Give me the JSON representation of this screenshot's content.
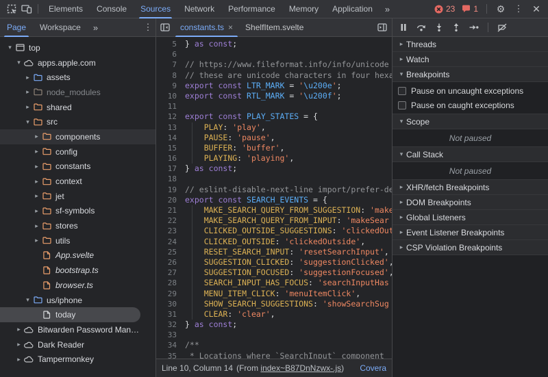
{
  "toolbar": {
    "tabs": [
      {
        "label": "Elements"
      },
      {
        "label": "Console"
      },
      {
        "label": "Sources",
        "active": true
      },
      {
        "label": "Network"
      },
      {
        "label": "Performance"
      },
      {
        "label": "Memory"
      },
      {
        "label": "Application"
      }
    ],
    "more_label": "»",
    "error_count": "23",
    "issue_count": "1",
    "gear": "⚙",
    "kebab": "⋮",
    "close": "✕"
  },
  "sidebar": {
    "tabs": [
      {
        "label": "Page",
        "active": true
      },
      {
        "label": "Workspace"
      }
    ],
    "more_label": "»",
    "kebab": "⋮",
    "tree": [
      {
        "label": "top",
        "icon": "frame",
        "color": "gray",
        "depth": 0,
        "chevron": "down"
      },
      {
        "label": "apps.apple.com",
        "icon": "cloud",
        "color": "gray",
        "depth": 1,
        "chevron": "down"
      },
      {
        "label": "assets",
        "icon": "folder",
        "color": "blue",
        "depth": 2,
        "chevron": "right"
      },
      {
        "label": "node_modules",
        "icon": "folder",
        "color": "dim",
        "depth": 2,
        "chevron": "right",
        "dim": true
      },
      {
        "label": "shared",
        "icon": "folder",
        "color": "orange",
        "depth": 2,
        "chevron": "right"
      },
      {
        "label": "src",
        "icon": "folder",
        "color": "orange",
        "depth": 2,
        "chevron": "down"
      },
      {
        "label": "components",
        "icon": "folder",
        "color": "orange",
        "depth": 3,
        "chevron": "right",
        "row": "hl"
      },
      {
        "label": "config",
        "icon": "folder",
        "color": "orange",
        "depth": 3,
        "chevron": "right"
      },
      {
        "label": "constants",
        "icon": "folder",
        "color": "orange",
        "depth": 3,
        "chevron": "right"
      },
      {
        "label": "context",
        "icon": "folder",
        "color": "orange",
        "depth": 3,
        "chevron": "right"
      },
      {
        "label": "jet",
        "icon": "folder",
        "color": "orange",
        "depth": 3,
        "chevron": "right"
      },
      {
        "label": "sf-symbols",
        "icon": "folder",
        "color": "orange",
        "depth": 3,
        "chevron": "right"
      },
      {
        "label": "stores",
        "icon": "folder",
        "color": "orange",
        "depth": 3,
        "chevron": "right"
      },
      {
        "label": "utils",
        "icon": "folder",
        "color": "orange",
        "depth": 3,
        "chevron": "right"
      },
      {
        "label": "App.svelte",
        "icon": "file",
        "color": "orange",
        "depth": 3,
        "italic": true
      },
      {
        "label": "bootstrap.ts",
        "icon": "file",
        "color": "orange",
        "depth": 3,
        "italic": true
      },
      {
        "label": "browser.ts",
        "icon": "file",
        "color": "orange",
        "depth": 3,
        "italic": true
      },
      {
        "label": "us/iphone",
        "icon": "folder",
        "color": "blue",
        "depth": 2,
        "chevron": "down"
      },
      {
        "label": "today",
        "icon": "file",
        "color": "white",
        "depth": 3,
        "row": "sel"
      },
      {
        "label": "Bitwarden Password Man…",
        "icon": "cloud",
        "color": "gray",
        "depth": 1,
        "chevron": "right"
      },
      {
        "label": "Dark Reader",
        "icon": "cloud",
        "color": "gray",
        "depth": 1,
        "chevron": "right"
      },
      {
        "label": "Tampermonkey",
        "icon": "cloud",
        "color": "gray",
        "depth": 1,
        "chevron": "right"
      }
    ]
  },
  "editor": {
    "tabs": [
      {
        "label": "constants.ts",
        "active": true,
        "close": "×"
      },
      {
        "label": "ShelfItem.svelte"
      }
    ],
    "lines": [
      {
        "n": 5,
        "seg": [
          [
            "p",
            "} "
          ],
          [
            "k",
            "as"
          ],
          [
            "p",
            " "
          ],
          [
            "k",
            "const"
          ],
          [
            "p",
            ";"
          ]
        ]
      },
      {
        "n": 6,
        "seg": []
      },
      {
        "n": 7,
        "seg": [
          [
            "c",
            "// https://www.fileformat.info/info/unicode"
          ]
        ]
      },
      {
        "n": 8,
        "seg": [
          [
            "c",
            "// these are unicode characters in four hexa"
          ]
        ]
      },
      {
        "n": 9,
        "seg": [
          [
            "k",
            "export"
          ],
          [
            "p",
            " "
          ],
          [
            "k",
            "const"
          ],
          [
            "p",
            " "
          ],
          [
            "d",
            "LTR_MARK"
          ],
          [
            "p",
            " = "
          ],
          [
            "s",
            "'"
          ],
          [
            "e",
            "\\u200e"
          ],
          [
            "s",
            "'"
          ],
          [
            "p",
            ";"
          ]
        ]
      },
      {
        "n": 10,
        "seg": [
          [
            "k",
            "export"
          ],
          [
            "p",
            " "
          ],
          [
            "k",
            "const"
          ],
          [
            "p",
            " "
          ],
          [
            "d",
            "RTL_MARK"
          ],
          [
            "p",
            " = "
          ],
          [
            "s",
            "'"
          ],
          [
            "e",
            "\\u200f"
          ],
          [
            "s",
            "'"
          ],
          [
            "p",
            ";"
          ]
        ]
      },
      {
        "n": 11,
        "seg": []
      },
      {
        "n": 12,
        "seg": [
          [
            "k",
            "export"
          ],
          [
            "p",
            " "
          ],
          [
            "k",
            "const"
          ],
          [
            "p",
            " "
          ],
          [
            "d",
            "PLAY_STATES"
          ],
          [
            "p",
            " = {"
          ]
        ]
      },
      {
        "n": 13,
        "guide": true,
        "seg": [
          [
            "p",
            "    "
          ],
          [
            "pr",
            "PLAY"
          ],
          [
            "p",
            ": "
          ],
          [
            "s",
            "'play'"
          ],
          [
            "p",
            ","
          ]
        ]
      },
      {
        "n": 14,
        "guide": true,
        "seg": [
          [
            "p",
            "    "
          ],
          [
            "pr",
            "PAUSE"
          ],
          [
            "p",
            ": "
          ],
          [
            "s",
            "'pause'"
          ],
          [
            "p",
            ","
          ]
        ]
      },
      {
        "n": 15,
        "guide": true,
        "seg": [
          [
            "p",
            "    "
          ],
          [
            "pr",
            "BUFFER"
          ],
          [
            "p",
            ": "
          ],
          [
            "s",
            "'buffer'"
          ],
          [
            "p",
            ","
          ]
        ]
      },
      {
        "n": 16,
        "guide": true,
        "seg": [
          [
            "p",
            "    "
          ],
          [
            "pr",
            "PLAYING"
          ],
          [
            "p",
            ": "
          ],
          [
            "s",
            "'playing'"
          ],
          [
            "p",
            ","
          ]
        ]
      },
      {
        "n": 17,
        "seg": [
          [
            "p",
            "} "
          ],
          [
            "k",
            "as"
          ],
          [
            "p",
            " "
          ],
          [
            "k",
            "const"
          ],
          [
            "p",
            ";"
          ]
        ]
      },
      {
        "n": 18,
        "seg": []
      },
      {
        "n": 19,
        "seg": [
          [
            "c",
            "// eslint-disable-next-line import/prefer-de"
          ]
        ]
      },
      {
        "n": 20,
        "seg": [
          [
            "k",
            "export"
          ],
          [
            "p",
            " "
          ],
          [
            "k",
            "const"
          ],
          [
            "p",
            " "
          ],
          [
            "d",
            "SEARCH_EVENTS"
          ],
          [
            "p",
            " = {"
          ]
        ]
      },
      {
        "n": 21,
        "guide": true,
        "seg": [
          [
            "p",
            "    "
          ],
          [
            "pr",
            "MAKE_SEARCH_QUERY_FROM_SUGGESTION"
          ],
          [
            "p",
            ": "
          ],
          [
            "s",
            "'make"
          ]
        ]
      },
      {
        "n": 22,
        "guide": true,
        "seg": [
          [
            "p",
            "    "
          ],
          [
            "pr",
            "MAKE_SEARCH_QUERY_FROM_INPUT"
          ],
          [
            "p",
            ": "
          ],
          [
            "s",
            "'makeSear"
          ]
        ]
      },
      {
        "n": 23,
        "guide": true,
        "seg": [
          [
            "p",
            "    "
          ],
          [
            "pr",
            "CLICKED_OUTSIDE_SUGGESTIONS"
          ],
          [
            "p",
            ": "
          ],
          [
            "s",
            "'clickedOut"
          ]
        ]
      },
      {
        "n": 24,
        "guide": true,
        "seg": [
          [
            "p",
            "    "
          ],
          [
            "pr",
            "CLICKED_OUTSIDE"
          ],
          [
            "p",
            ": "
          ],
          [
            "s",
            "'clickedOutside'"
          ],
          [
            "p",
            ","
          ]
        ]
      },
      {
        "n": 25,
        "guide": true,
        "seg": [
          [
            "p",
            "    "
          ],
          [
            "pr",
            "RESET_SEARCH_INPUT"
          ],
          [
            "p",
            ": "
          ],
          [
            "s",
            "'resetSearchInput'"
          ],
          [
            "p",
            ","
          ]
        ]
      },
      {
        "n": 26,
        "guide": true,
        "seg": [
          [
            "p",
            "    "
          ],
          [
            "pr",
            "SUGGESTION_CLICKED"
          ],
          [
            "p",
            ": "
          ],
          [
            "s",
            "'suggestionClicked'"
          ],
          [
            "p",
            ","
          ]
        ]
      },
      {
        "n": 27,
        "guide": true,
        "seg": [
          [
            "p",
            "    "
          ],
          [
            "pr",
            "SUGGESTION_FOCUSED"
          ],
          [
            "p",
            ": "
          ],
          [
            "s",
            "'suggestionFocused'"
          ],
          [
            "p",
            ","
          ]
        ]
      },
      {
        "n": 28,
        "guide": true,
        "seg": [
          [
            "p",
            "    "
          ],
          [
            "pr",
            "SEARCH_INPUT_HAS_FOCUS"
          ],
          [
            "p",
            ": "
          ],
          [
            "s",
            "'searchInputHas"
          ]
        ]
      },
      {
        "n": 29,
        "guide": true,
        "seg": [
          [
            "p",
            "    "
          ],
          [
            "pr",
            "MENU_ITEM_CLICK"
          ],
          [
            "p",
            ": "
          ],
          [
            "s",
            "'menuItemClick'"
          ],
          [
            "p",
            ","
          ]
        ]
      },
      {
        "n": 30,
        "guide": true,
        "seg": [
          [
            "p",
            "    "
          ],
          [
            "pr",
            "SHOW_SEARCH_SUGGESTIONS"
          ],
          [
            "p",
            ": "
          ],
          [
            "s",
            "'showSearchSug"
          ]
        ]
      },
      {
        "n": 31,
        "guide": true,
        "seg": [
          [
            "p",
            "    "
          ],
          [
            "pr",
            "CLEAR"
          ],
          [
            "p",
            ": "
          ],
          [
            "s",
            "'clear'"
          ],
          [
            "p",
            ","
          ]
        ]
      },
      {
        "n": 32,
        "seg": [
          [
            "p",
            "} "
          ],
          [
            "k",
            "as"
          ],
          [
            "p",
            " "
          ],
          [
            "k",
            "const"
          ],
          [
            "p",
            ";"
          ]
        ]
      },
      {
        "n": 33,
        "seg": []
      },
      {
        "n": 34,
        "seg": [
          [
            "c",
            "/**"
          ]
        ]
      },
      {
        "n": 35,
        "seg": [
          [
            "c",
            " * Locations where `SearchInput` component"
          ]
        ]
      }
    ],
    "status": {
      "position": "Line 10, Column 14",
      "from_prefix": "(From ",
      "from_file": "index~B87DnNzwx-.js",
      "from_suffix": ")",
      "coverage": "Covera"
    }
  },
  "debugger": {
    "toolbar_icons": [
      "pause",
      "step-over",
      "step-into",
      "step-out",
      "step",
      "sep",
      "deactivate-breakpoints"
    ],
    "sections": [
      {
        "label": "Threads",
        "chevron": "right"
      },
      {
        "label": "Watch",
        "chevron": "right"
      },
      {
        "label": "Breakpoints",
        "chevron": "down",
        "checkboxes": [
          "Pause on uncaught exceptions",
          "Pause on caught exceptions"
        ]
      },
      {
        "label": "Scope",
        "chevron": "down",
        "message": "Not paused"
      },
      {
        "label": "Call Stack",
        "chevron": "down",
        "message": "Not paused"
      },
      {
        "label": "XHR/fetch Breakpoints",
        "chevron": "right"
      },
      {
        "label": "DOM Breakpoints",
        "chevron": "right"
      },
      {
        "label": "Global Listeners",
        "chevron": "right"
      },
      {
        "label": "Event Listener Breakpoints",
        "chevron": "right"
      },
      {
        "label": "CSP Violation Breakpoints",
        "chevron": "right"
      }
    ]
  },
  "colors": {
    "accent_blue": "#7cacf8",
    "error_red": "#e46962",
    "keyword_purple": "#9e7fd6",
    "string_orange": "#ef8862",
    "property_gold": "#ddb254",
    "def_blue": "#5caef7"
  }
}
